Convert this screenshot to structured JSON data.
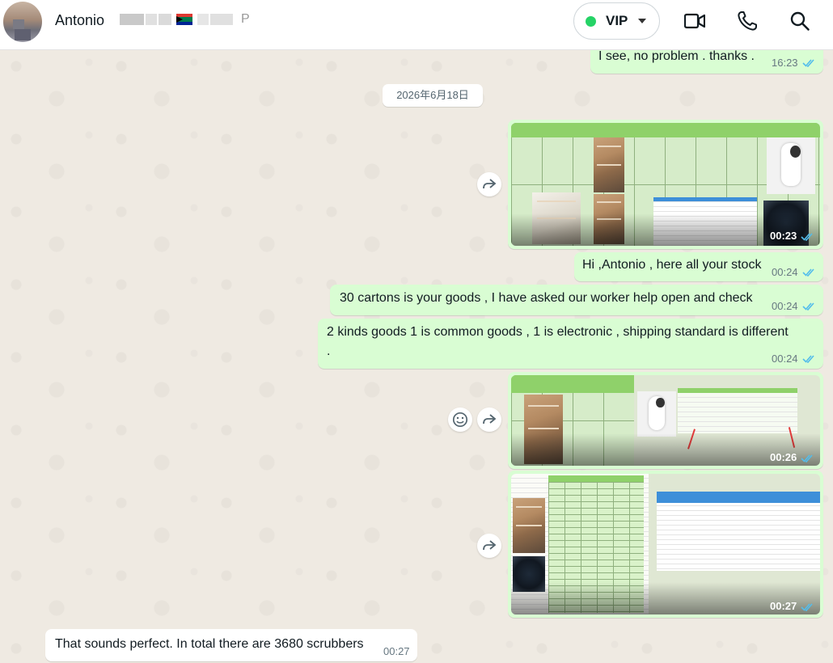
{
  "header": {
    "contact_name": "Antonio",
    "contact_tail": "P",
    "vip_label": "VIP",
    "vip_status_color": "#25d366",
    "icons": [
      "video-call-icon",
      "voice-call-icon",
      "search-icon"
    ]
  },
  "date_chip": "2026年6月18日",
  "messages": [
    {
      "id": "m1",
      "dir": "out",
      "text": "I see, no problem .  thanks  .",
      "time": "16:23",
      "read": true
    },
    {
      "id": "m2",
      "dir": "out",
      "type": "video",
      "time": "00:23",
      "read": true
    },
    {
      "id": "m3",
      "dir": "out",
      "text": "Hi ,Antonio , here all your stock",
      "time": "00:24",
      "read": true
    },
    {
      "id": "m4",
      "dir": "out",
      "text": "30 cartons is your goods , I have asked our worker help open and check",
      "time": "00:24",
      "read": true
    },
    {
      "id": "m5",
      "dir": "out",
      "text": "2 kinds goods 1 is common goods , 1 is electronic , shipping standard is different",
      "text2": ".",
      "time": "00:24",
      "read": true
    },
    {
      "id": "m6",
      "dir": "out",
      "type": "video",
      "time": "00:26",
      "read": true
    },
    {
      "id": "m7",
      "dir": "out",
      "type": "video",
      "time": "00:27",
      "read": true
    },
    {
      "id": "m8",
      "dir": "in",
      "text": "That sounds perfect. In total there are 3680 scrubbers",
      "time": "00:27"
    }
  ],
  "sheet1": {
    "headers": [
      "box No.",
      "tracking number",
      "box picture",
      "box qty",
      "box details",
      "goods weight kg",
      "boxes volume m³",
      "Goods Name",
      "Goods picture"
    ],
    "rows": [
      "1",
      "2"
    ],
    "qty": "4",
    "qty2": "30",
    "detail": "装柜后4件，33.5kg 51×53×54cm"
  },
  "sheet2": {
    "headers": [
      "box picture",
      "box qty",
      "box details"
    ],
    "qty": "4",
    "detail": "装柜后4件，33.5kg 51×53×54cm，5.2kg 42×29×40",
    "calc_headers": [
      "GW",
      "Size cm",
      "CBM"
    ],
    "calc_rows": [
      [
        "13.6",
        "51",
        "53",
        "54",
        "0.00"
      ],
      [
        "13.6",
        "51",
        "53",
        "54",
        "0.00"
      ],
      [
        "13.6",
        "51",
        "53",
        "54",
        "0.00"
      ],
      [
        "5.2",
        "42",
        "29",
        "40",
        "0.04"
      ]
    ],
    "calc_total_label": "total",
    "calc_total_gw": "45.7",
    "calc_total_cbm": "0.20"
  },
  "colors": {
    "outgoing_bubble": "#d9fdd3",
    "incoming_bubble": "#ffffff",
    "read_ticks": "#53bdeb",
    "wallpaper": "#efeae2"
  }
}
